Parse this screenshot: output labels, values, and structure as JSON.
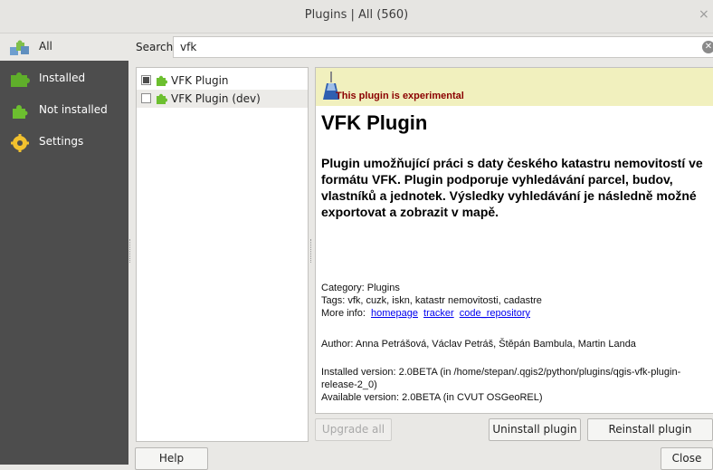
{
  "window": {
    "title": "Plugins | All (560)",
    "close_glyph": "×"
  },
  "sidebar": {
    "items": [
      {
        "label": "All",
        "icon": "all-plugins-icon"
      },
      {
        "label": "Installed",
        "icon": "installed-puzzle-icon"
      },
      {
        "label": "Not installed",
        "icon": "not-installed-puzzle-icon"
      },
      {
        "label": "Settings",
        "icon": "settings-gear-icon"
      }
    ]
  },
  "search": {
    "label": "Search",
    "value": "vfk",
    "clear_glyph": "✕"
  },
  "plugins": [
    {
      "name": "VFK Plugin",
      "checked": true
    },
    {
      "name": "VFK Plugin (dev)",
      "checked": false
    }
  ],
  "details": {
    "experimental_warning": "This plugin is experimental",
    "title": "VFK Plugin",
    "description": "Plugin umožňující práci s daty českého katastru nemovitostí ve formátu VFK. Plugin podporuje vyhledávání parcel, budov, vlastníků a jednotek. Výsledky vyhledávání je následně možné exportovat a zobrazit v mapě.",
    "category": "Category: Plugins",
    "tags": "Tags: vfk, cuzk, iskn, katastr nemovitosti, cadastre",
    "more_info_label": "More info:",
    "links": {
      "homepage": "homepage",
      "tracker": "tracker",
      "code_repository": "code_repository"
    },
    "author": "Author: Anna Petrášová, Václav Petráš, Štěpán Bambula, Martin Landa",
    "installed_version": "Installed version: 2.0BETA (in /home/stepan/.qgis2/python/plugins/qgis-vfk-plugin-release-2_0)",
    "available_version": "Available version: 2.0BETA (in CVUT OSGeoREL)"
  },
  "buttons": {
    "upgrade_all": "Upgrade all",
    "uninstall": "Uninstall plugin",
    "reinstall": "Reinstall plugin",
    "help": "Help",
    "close": "Close"
  },
  "colors": {
    "sidebar_bg": "#4d4d4d",
    "warning_bg": "#f1f0be",
    "warning_text": "#8b0000",
    "link": "#0000ee"
  }
}
